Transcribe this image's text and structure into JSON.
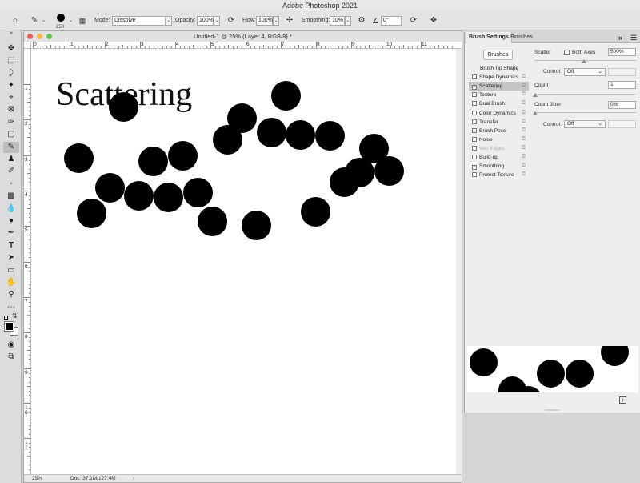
{
  "app": {
    "title": "Adobe Photoshop 2021"
  },
  "options_bar": {
    "brush_size": "250",
    "mode_label": "Mode:",
    "mode_value": "Dissolve",
    "opacity_label": "Opacity:",
    "opacity_value": "100%",
    "flow_label": "Flow:",
    "flow_value": "100%",
    "smoothing_label": "Smoothing:",
    "smoothing_value": "10%",
    "angle_value": "0°"
  },
  "document": {
    "title": "Untitled-1 @ 25% (Layer 4, RGB/8) *",
    "zoom": "25%",
    "doc_size": "Doc: 37.1M/127.4M",
    "canvas_text": "Scattering",
    "ruler_h": [
      "0",
      "1",
      "2",
      "3",
      "4",
      "5",
      "6",
      "7",
      "8",
      "9",
      "10",
      "11"
    ],
    "ruler_v": [
      "1",
      "2",
      "3",
      "4",
      "5",
      "6",
      "7",
      "8",
      "9",
      "1\n0",
      "1\n1"
    ]
  },
  "brush_panel": {
    "tab_active": "Brush Settings",
    "tab_inactive": "Brushes",
    "brushes_button": "Brushes",
    "items": [
      {
        "label": "Brush Tip Shape",
        "checkbox": false,
        "checked": false,
        "lock": false,
        "selected": false,
        "disabled": false
      },
      {
        "label": "Shape Dynamics",
        "checkbox": true,
        "checked": false,
        "lock": true,
        "selected": false,
        "disabled": false
      },
      {
        "label": "Scattering",
        "checkbox": true,
        "checked": true,
        "lock": true,
        "selected": true,
        "disabled": false
      },
      {
        "label": "Texture",
        "checkbox": true,
        "checked": false,
        "lock": true,
        "selected": false,
        "disabled": false
      },
      {
        "label": "Dual Brush",
        "checkbox": true,
        "checked": false,
        "lock": true,
        "selected": false,
        "disabled": false
      },
      {
        "label": "Color Dynamics",
        "checkbox": true,
        "checked": false,
        "lock": true,
        "selected": false,
        "disabled": false
      },
      {
        "label": "Transfer",
        "checkbox": true,
        "checked": false,
        "lock": true,
        "selected": false,
        "disabled": false
      },
      {
        "label": "Brush Pose",
        "checkbox": true,
        "checked": false,
        "lock": true,
        "selected": false,
        "disabled": false
      },
      {
        "label": "Noise",
        "checkbox": true,
        "checked": false,
        "lock": true,
        "selected": false,
        "disabled": false
      },
      {
        "label": "Wet Edges",
        "checkbox": true,
        "checked": false,
        "lock": true,
        "selected": false,
        "disabled": true
      },
      {
        "label": "Build-up",
        "checkbox": true,
        "checked": false,
        "lock": true,
        "selected": false,
        "disabled": false
      },
      {
        "label": "Smoothing",
        "checkbox": true,
        "checked": true,
        "lock": true,
        "selected": false,
        "disabled": false
      },
      {
        "label": "Protect Texture",
        "checkbox": true,
        "checked": false,
        "lock": true,
        "selected": false,
        "disabled": false
      }
    ],
    "scatter_label": "Scatter",
    "both_axes_label": "Both Axes",
    "scatter_value": "500%",
    "control_label": "Control:",
    "control_value": "Off",
    "count_label": "Count",
    "count_value": "1",
    "count_jitter_label": "Count Jitter",
    "count_jitter_value": "0%",
    "control2_label": "Control:",
    "control2_value": "Off"
  },
  "icons": {
    "home": "home-icon",
    "brush": "brush-icon",
    "toggle_panel": "brush-panel-toggle-icon",
    "airbrush": "airbrush-icon",
    "angle": "angle-icon",
    "pressure_size": "pressure-size-icon",
    "symmetry": "symmetry-icon",
    "smoothing_settings": "gear-icon"
  },
  "colors": {
    "foreground": "#000000",
    "background": "#ffffff",
    "ui_gray": "#e4e4e4"
  }
}
